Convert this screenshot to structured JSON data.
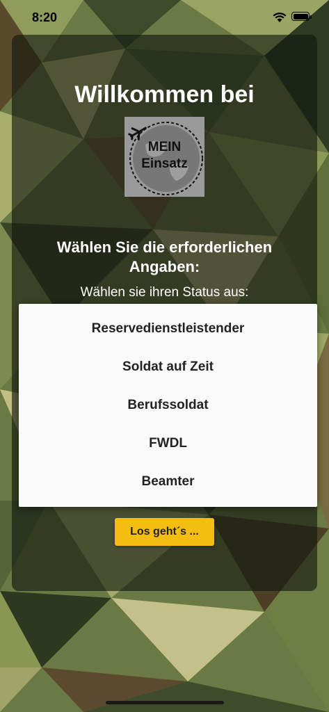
{
  "status_bar": {
    "time": "8:20"
  },
  "welcome": {
    "title": "Willkommen bei"
  },
  "logo": {
    "line1": "MEIN",
    "line2": "Einsatz"
  },
  "form": {
    "prompt": "Wählen Sie die erforderlichen Angaben:",
    "status_label": "Wählen sie ihren Status aus:",
    "status_options": [
      "Reservedienstleistender",
      "Soldat auf Zeit",
      "Berufssoldat",
      "FWDL",
      "Beamter"
    ],
    "submit_label": "Los geht´s ..."
  },
  "colors": {
    "accent": "#f4bd12",
    "panel": "#12160e",
    "picker_bg": "#fafafa"
  }
}
